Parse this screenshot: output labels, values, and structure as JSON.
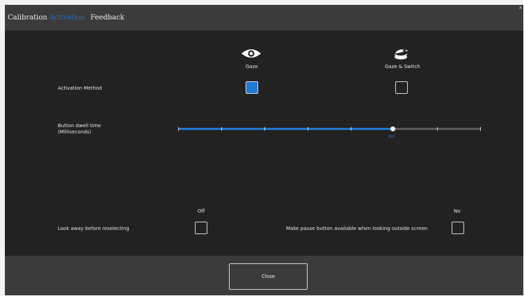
{
  "tabs": [
    {
      "label": "Calibration",
      "active": false
    },
    {
      "label": "Activation",
      "active": true
    },
    {
      "label": "Feedback",
      "active": false
    }
  ],
  "window": {
    "close_glyph": "x"
  },
  "activation_method": {
    "label": "Activation Method",
    "options": [
      {
        "label": "Gaze",
        "icon": "eye-icon",
        "checked": true
      },
      {
        "label": "Gaze & Switch",
        "icon": "gaze-switch-icon",
        "checked": false
      }
    ]
  },
  "dwell_time": {
    "label_line1": "Button dwell time",
    "label_line2": "(Milliseconds)",
    "value_label": "900",
    "fraction": 0.71,
    "tick_count": 8
  },
  "look_away": {
    "label": "Look away before reselecting",
    "state_label": "Off",
    "checked": false
  },
  "pause_button": {
    "label": "Make pause button available when looking outside screen",
    "state_label": "No",
    "checked": false
  },
  "footer": {
    "close_label": "Close"
  },
  "colors": {
    "accent": "#1f78d1",
    "active_tab": "#1f6fcf",
    "background": "#222222",
    "bar": "#3b3b3b"
  }
}
